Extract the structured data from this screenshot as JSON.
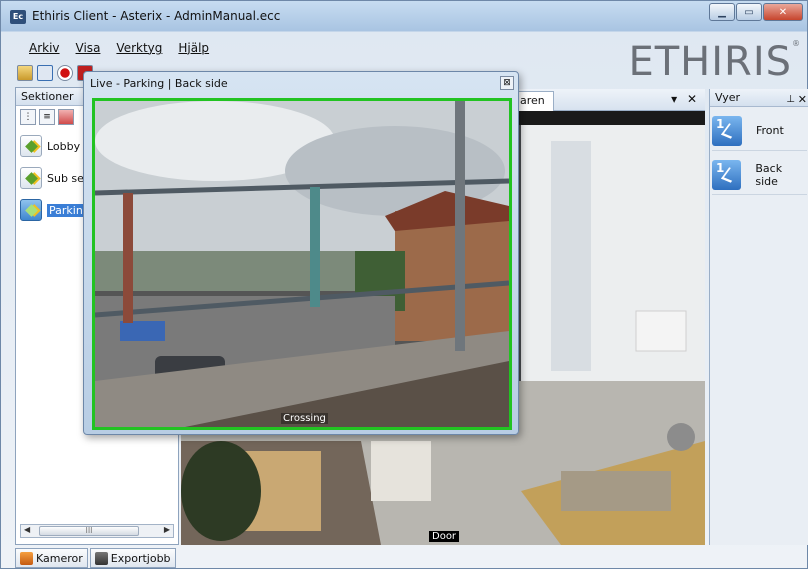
{
  "window": {
    "app_icon": "Ec",
    "title": "Ethiris Client - Asterix - AdminManual.ecc",
    "minimize_icon": "minimize-icon",
    "maximize_icon": "maximize-icon",
    "close_icon": "close-icon"
  },
  "menu": {
    "items": [
      "Arkiv",
      "Visa",
      "Verktyg",
      "Hjälp"
    ]
  },
  "brand": {
    "text": "ETHIRIS",
    "mark": "®"
  },
  "sections": {
    "title": "Sektioner",
    "items": [
      {
        "label": "Lobby",
        "selected": false
      },
      {
        "label": "Sub sec",
        "selected": false
      },
      {
        "label": "Parking",
        "selected": true
      }
    ],
    "scrollbar_grip": "III"
  },
  "bottom_tabs": [
    "Kameror",
    "Exportjobb"
  ],
  "main": {
    "tab_label": "aren",
    "dropdown_icon": "chevron-down-icon",
    "close_icon": "close-icon",
    "video_caption": "Door"
  },
  "views": {
    "title": "Vyer",
    "pin_icon": "pin-icon",
    "items": [
      {
        "badge": "1",
        "label": "Front"
      },
      {
        "badge": "1",
        "label": "Back side"
      }
    ]
  },
  "live": {
    "title": "Live - Parking | Back side",
    "caption": "Crossing",
    "close_glyph": "⊠"
  },
  "colors": {
    "active_frame": "#22c322",
    "selection": "#3a7ed6"
  }
}
